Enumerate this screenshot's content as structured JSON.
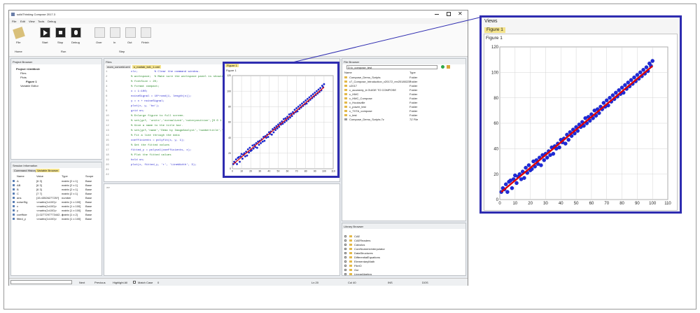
{
  "app": {
    "title": "solidThinking Compose 2017.3",
    "menu": [
      "File",
      "Edit",
      "View",
      "Tools",
      "Debug"
    ],
    "ribbon_groups": [
      "Home",
      "Run",
      "Step"
    ],
    "ribbon_buttons": [
      "File",
      "Start",
      "Stop",
      "Debug",
      "Over",
      "In",
      "Out",
      "Finish"
    ]
  },
  "project_browser": {
    "title": "Project Browser",
    "items": [
      "Project <Untitled>",
      "Files",
      "Plots",
      "Figure 1",
      "Variable Editor"
    ]
  },
  "session": {
    "title": "Session Information",
    "tabs": [
      "Command History",
      "Variable Browser"
    ],
    "columns": [
      "Name",
      "Value",
      "Type",
      "Scope"
    ],
    "rows": [
      [
        "A",
        "[6 3]",
        "matrix [2 x 1]",
        "Base"
      ],
      [
        "AB",
        "[6 3]",
        "matrix [2 x 1]",
        "Base"
      ],
      [
        "B",
        "[6 3]",
        "matrix [2 x 1]",
        "Base"
      ],
      [
        "C",
        "[7 7]",
        "matrix [2 x 1]",
        "Base"
      ],
      [
        "ans",
        "[15.4352627725?]",
        "number",
        "Base"
      ],
      [
        "noiseSig",
        "<matrix(1x100)>",
        "matrix [1 x 100]",
        "Base"
      ],
      [
        "x",
        "<matrix(1x100)>",
        "matrix [1 x 100]",
        "Base"
      ],
      [
        "y",
        "<matrix(1x100)>",
        "matrix [1 x 100]",
        "Base"
      ],
      [
        "coefficie",
        "[1.0277297773442...]",
        "matrix [1 x 2]",
        "Base"
      ],
      [
        "fitted_y",
        "<matrix(1x100)>",
        "matrix [1 x 100]",
        "Base"
      ]
    ]
  },
  "editor": {
    "label": "Files",
    "tabs": [
      "mom_conveld.oml",
      "s_matlab_tst1_1.oml"
    ],
    "line_numbers": [
      "1",
      "2",
      "3",
      "4",
      "5",
      "6",
      "7",
      "8",
      "9",
      "10",
      "11",
      "12",
      "13",
      "14",
      "15",
      "16",
      "17",
      "18",
      "19",
      "20",
      "21",
      "22"
    ],
    "lines": [
      "clc;          % Clear the command window.",
      "% workspace;  % Make sure the workspace panel is showing.",
      "% fontSize = 20;",
      "% format compact;",
      "x = 1:100;",
      "noiseSignal = 10*rand(1, length(x));",
      "y = x + noiseSignal;",
      "plot(x, y, 'bo');",
      "grid on;",
      "% Enlarge figure to full screen.",
      "% set(gcf, 'units','normalized','outerposition',[0 0 1 1]);",
      "% Give a name to the title bar.",
      "% set(gcf,'name','Demo by ImageAnalyst','numbertitle','off')",
      "% Fit a line through the data",
      "coefficients = polyfit(x, y, 1);",
      "% Get the fitted values",
      "fitted_y = polyval(coefficients, x);",
      "% Plot the fitted values",
      "hold on;",
      "plot(x, fitted_y, 'r', 'LineWidth', 3);",
      "",
      ""
    ]
  },
  "file_browser": {
    "title": "File Browser",
    "path": "D:\\c_compose_test",
    "columns": [
      "Name",
      "Type"
    ],
    "rows": [
      [
        "Compose_Demo_Scripts",
        "Folder"
      ],
      [
        "c7_Compose_Introduction_v20172_rev20180223",
        "Folder"
      ],
      [
        "c2017",
        "Folder"
      ],
      [
        "c_acumedy_A GUIDE TO COMPOSE",
        "Folder"
      ],
      [
        "c_HMC",
        "Folder"
      ],
      [
        "c_HMC_Compose",
        "Folder"
      ],
      [
        "c_Hooksville",
        "Folder"
      ],
      [
        "c_power_test",
        "Folder"
      ],
      [
        "c_TXTA_compose",
        "Folder"
      ],
      [
        "c_test",
        "Folder"
      ],
      [
        "Compose_Demo_Scripts.7z",
        "7Z File"
      ]
    ]
  },
  "library_browser": {
    "title": "Library Browser",
    "items": [
      "CAE",
      "CAEReaders",
      "Calculus",
      "CoreNumericInterpolator",
      "DataStructures",
      "DifferentialEquations",
      "ElementaryMath",
      "FileIO",
      "Gui",
      "LinearAlgebra"
    ]
  },
  "statusbar": {
    "buttons": [
      "Next",
      "Previous",
      "Highlight All"
    ],
    "match_case": "Match Case",
    "match_count": "0",
    "ln": "Ln 20",
    "col": "Col 40",
    "ins": "INS",
    "dos": "DOS"
  },
  "views_panel": {
    "title": "Views",
    "tab": "Figure 1",
    "figure_label": "Figure 1"
  },
  "colors": {
    "highlight": "#2e2cb0",
    "marker": "#1f2ad8",
    "fit_line": "#e00000",
    "tab_active": "#f3e28a"
  },
  "chart_data": {
    "type": "scatter",
    "xlim": [
      0,
      110
    ],
    "ylim": [
      0,
      120
    ],
    "xticks": [
      0,
      10,
      20,
      30,
      40,
      50,
      60,
      70,
      80,
      90,
      100,
      110
    ],
    "yticks": [
      0,
      20,
      40,
      60,
      80,
      100,
      120
    ],
    "grid": true,
    "scatter_style": "blue circles",
    "fit": {
      "slope": 1.0,
      "intercept": 5.0,
      "color": "#e00000"
    },
    "series": [
      {
        "x": [
          1,
          2,
          3,
          4,
          5,
          6,
          7,
          8,
          9,
          10,
          11,
          12,
          13,
          14,
          15,
          16,
          17,
          18,
          19,
          20,
          21,
          22,
          23,
          24,
          25,
          26,
          27,
          28,
          29,
          30,
          31,
          32,
          33,
          34,
          35,
          36,
          37,
          38,
          39,
          40,
          41,
          42,
          43,
          44,
          45,
          46,
          47,
          48,
          49,
          50,
          51,
          52,
          53,
          54,
          55,
          56,
          57,
          58,
          59,
          60,
          61,
          62,
          63,
          64,
          65,
          66,
          67,
          68,
          69,
          70,
          71,
          72,
          73,
          74,
          75,
          76,
          77,
          78,
          79,
          80,
          81,
          82,
          83,
          84,
          85,
          86,
          87,
          88,
          89,
          90,
          91,
          92,
          93,
          94,
          95,
          96,
          97,
          98,
          99,
          100
        ],
        "y": [
          6,
          9,
          8,
          12,
          6,
          14,
          15,
          9,
          16,
          19,
          13,
          18,
          20,
          16,
          22,
          17,
          25,
          21,
          27,
          23,
          24,
          30,
          26,
          31,
          28,
          33,
          27,
          35,
          31,
          36,
          33,
          38,
          35,
          41,
          36,
          42,
          40,
          44,
          41,
          47,
          45,
          48,
          44,
          51,
          47,
          53,
          50,
          55,
          52,
          57,
          54,
          59,
          57,
          61,
          58,
          64,
          60,
          65,
          62,
          67,
          64,
          70,
          66,
          71,
          68,
          73,
          71,
          76,
          73,
          78,
          74,
          80,
          77,
          82,
          79,
          84,
          81,
          86,
          83,
          88,
          84,
          90,
          87,
          92,
          89,
          94,
          91,
          96,
          93,
          98,
          95,
          100,
          97,
          102,
          99,
          104,
          101,
          107,
          105,
          109
        ]
      }
    ]
  }
}
